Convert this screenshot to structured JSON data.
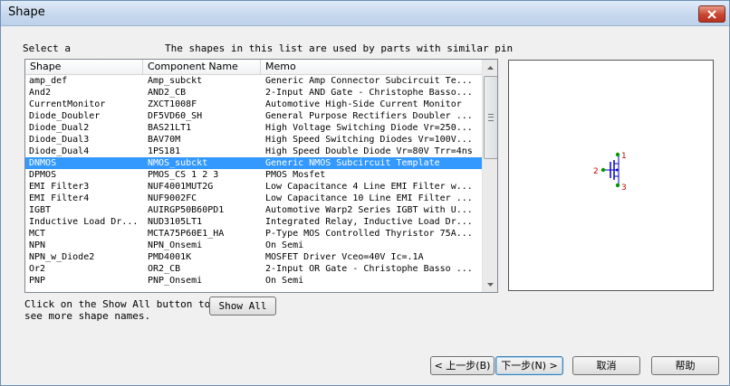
{
  "window": {
    "title": "Shape"
  },
  "prompt": {
    "left": "Select a",
    "right": "The shapes in this list are used by parts with similar pin"
  },
  "table": {
    "columns": [
      "Shape",
      "Component Name",
      "Memo"
    ],
    "rows": [
      {
        "shape": "amp_def",
        "component": "Amp_subckt",
        "memo": "Generic Amp Connector Subcircuit Te..."
      },
      {
        "shape": "And2",
        "component": "AND2_CB",
        "memo": "2-Input AND Gate - Christophe Basso..."
      },
      {
        "shape": "CurrentMonitor",
        "component": "ZXCT1008F",
        "memo": "Automotive High-Side Current Monitor"
      },
      {
        "shape": "Diode_Doubler",
        "component": "DF5VD60_SH",
        "memo": "General Purpose Rectifiers Doubler ..."
      },
      {
        "shape": "Diode_Dual2",
        "component": "BAS21LT1",
        "memo": "High Voltage Switching Diode Vr=250..."
      },
      {
        "shape": "Diode_Dual3",
        "component": "BAV70M",
        "memo": "High Speed Switching Diodes Vr=100V..."
      },
      {
        "shape": "Diode_Dual4",
        "component": "1PS181",
        "memo": "High Speed Double Diode Vr=80V Trr=4ns"
      },
      {
        "shape": "DNMOS",
        "component": "NMOS_subckt",
        "memo": "Generic NMOS Subcircuit Template",
        "selected": true
      },
      {
        "shape": "DPMOS",
        "component": "PMOS_CS 1 2 3",
        "memo": "PMOS Mosfet"
      },
      {
        "shape": "EMI Filter3",
        "component": "NUF4001MUT2G",
        "memo": "Low Capacitance 4 Line EMI Filter w..."
      },
      {
        "shape": "EMI Filter4",
        "component": "NUF9002FC",
        "memo": "Low Capacitance 10 Line EMI Filter ..."
      },
      {
        "shape": "IGBT",
        "component": "AUIRGP50B60PD1",
        "memo": "Automotive Warp2 Series IGBT with U..."
      },
      {
        "shape": "Inductive Load Dr...",
        "component": "NUD3105LT1",
        "memo": "Integrated Relay, Inductive Load Dr..."
      },
      {
        "shape": "MCT",
        "component": "MCTA75P60E1_HA",
        "memo": "P-Type MOS Controlled Thyristor 75A..."
      },
      {
        "shape": "NPN",
        "component": "NPN_Onsemi",
        "memo": "On Semi"
      },
      {
        "shape": "NPN_w_Diode2",
        "component": "PMD4001K",
        "memo": "MOSFET Driver Vceo=40V Ic=.1A"
      },
      {
        "shape": "Or2",
        "component": "OR2_CB",
        "memo": "2-Input OR Gate - Christophe Basso ..."
      },
      {
        "shape": "PNP",
        "component": "PNP_Onsemi",
        "memo": "On Semi"
      }
    ]
  },
  "preview": {
    "pins": [
      "1",
      "2",
      "3"
    ],
    "pin_color": "#009900",
    "label_color": "#cc0000",
    "body_color": "#0000cc"
  },
  "help": {
    "line1": "Click on the Show All button to",
    "line2": "see more shape names."
  },
  "buttons": {
    "show_all": "Show All",
    "back": "< 上一步(B)",
    "next": "下一步(N) >",
    "cancel": "取消",
    "help": "帮助"
  }
}
